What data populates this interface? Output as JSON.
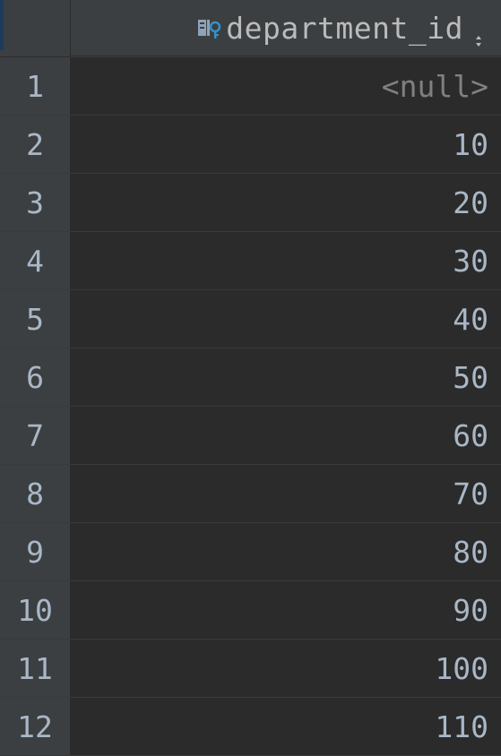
{
  "table": {
    "column": {
      "name": "department_id",
      "icon": "column-key-icon",
      "sort_icon": "sort-arrows-icon"
    },
    "rows": [
      {
        "num": "1",
        "value": "<null>",
        "is_null": true
      },
      {
        "num": "2",
        "value": "10"
      },
      {
        "num": "3",
        "value": "20"
      },
      {
        "num": "4",
        "value": "30"
      },
      {
        "num": "5",
        "value": "40"
      },
      {
        "num": "6",
        "value": "50"
      },
      {
        "num": "7",
        "value": "60"
      },
      {
        "num": "8",
        "value": "70"
      },
      {
        "num": "9",
        "value": "80"
      },
      {
        "num": "10",
        "value": "90"
      },
      {
        "num": "11",
        "value": "100"
      },
      {
        "num": "12",
        "value": "110"
      }
    ]
  },
  "colors": {
    "background": "#2b2b2b",
    "gutter": "#3c3f41",
    "text": "#a9b7c6",
    "null_text": "#808080",
    "icon_accent": "#3592c4"
  }
}
